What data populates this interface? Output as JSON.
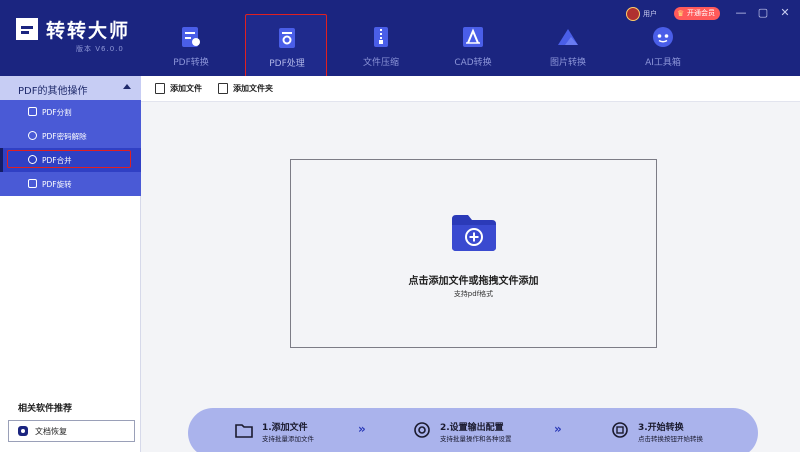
{
  "app": {
    "title": "转转大师",
    "version": "版本 V6.0.0",
    "user_name": "用户",
    "vip_label": "开通会员",
    "window_controls": [
      "—",
      "▢",
      "✕"
    ]
  },
  "nav": [
    {
      "label": "PDF转换",
      "icon": "file-convert-icon"
    },
    {
      "label": "PDF处理",
      "icon": "pdf-process-icon",
      "active": true
    },
    {
      "label": "文件压缩",
      "icon": "file-zip-icon"
    },
    {
      "label": "CAD转换",
      "icon": "cad-icon"
    },
    {
      "label": "图片转换",
      "icon": "image-icon"
    },
    {
      "label": "AI工具箱",
      "icon": "ai-robot-icon"
    }
  ],
  "sidebar": {
    "section_label": "PDF的其他操作",
    "items": [
      {
        "label": "PDF分割",
        "icon": "split-icon"
      },
      {
        "label": "PDF密码解除",
        "icon": "unlock-icon"
      },
      {
        "label": "PDF合并",
        "icon": "merge-icon",
        "selected": true
      },
      {
        "label": "PDF旋转",
        "icon": "rotate-icon"
      }
    ],
    "related_title": "相关软件推荐",
    "related_button": "文档恢复"
  },
  "toolbar": {
    "add_file": "添加文件",
    "add_folder": "添加文件夹"
  },
  "dropzone": {
    "main_text": "点击添加文件或拖拽文件添加",
    "sub_text": "支持pdf格式"
  },
  "steps": [
    {
      "title": "1.添加文件",
      "desc": "支持批量添加文件",
      "icon": "folder-icon"
    },
    {
      "title": "2.设置输出配置",
      "desc": "支持批量操作和各种设置",
      "icon": "settings-icon"
    },
    {
      "title": "3.开始转换",
      "desc": "点击转换按钮开始转换",
      "icon": "convert-icon"
    }
  ],
  "step_separator": "»",
  "colors": {
    "header_bg": "#1b2580",
    "sidebar_list_bg": "#4a5ad6",
    "sidebar_head_bg": "#c7cdf4",
    "highlight_red": "#e02020",
    "steps_bg": "#aab3ec",
    "folder_blue": "#2b3ab8"
  }
}
